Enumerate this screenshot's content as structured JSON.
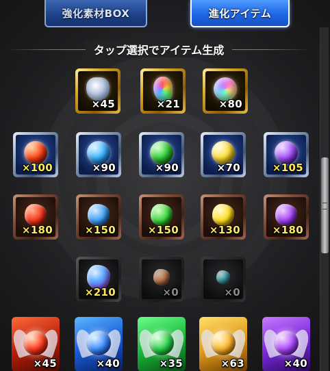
{
  "tabs": {
    "enhance_box": "強化素材BOX",
    "evolution_items": "進化アイテム"
  },
  "header": {
    "instruction": "タップ選択でアイテム生成"
  },
  "colors": {
    "gold_frame": "#d8a623",
    "silver_frame": "#8da3c2",
    "bronze_frame": "#7c4a36",
    "active_tab": "#1f66e6"
  },
  "row1": [
    {
      "icon": "silver-crest-icon",
      "count": "×45"
    },
    {
      "icon": "rainbow-swirl-icon",
      "count": "×21"
    },
    {
      "icon": "rainbow-orb-icon",
      "count": "×80"
    }
  ],
  "row2": [
    {
      "icon": "fire-orb-icon",
      "count": "×100"
    },
    {
      "icon": "water-orb-icon",
      "count": "×90"
    },
    {
      "icon": "wood-orb-icon",
      "count": "×90"
    },
    {
      "icon": "light-orb-icon",
      "count": "×70"
    },
    {
      "icon": "dark-orb-icon",
      "count": "×105"
    }
  ],
  "row3": [
    {
      "icon": "fire-stone-icon",
      "count": "×180"
    },
    {
      "icon": "water-stone-icon",
      "count": "×150"
    },
    {
      "icon": "wood-stone-icon",
      "count": "×150"
    },
    {
      "icon": "light-stone-icon",
      "count": "×130"
    },
    {
      "icon": "dark-stone-icon",
      "count": "×180"
    }
  ],
  "row4": [
    {
      "icon": "crystal-stone-icon",
      "count": "×210"
    },
    {
      "icon": "small-fire-stone-icon",
      "count": "×0"
    },
    {
      "icon": "small-water-stone-icon",
      "count": "×0"
    }
  ],
  "row5": [
    {
      "icon": "fire-evolution-card-icon",
      "count": "×45"
    },
    {
      "icon": "water-evolution-card-icon",
      "count": "×40"
    },
    {
      "icon": "wood-evolution-card-icon",
      "count": "×35"
    },
    {
      "icon": "light-evolution-card-icon",
      "count": "×63"
    },
    {
      "icon": "dark-evolution-card-icon",
      "count": "×40"
    }
  ]
}
